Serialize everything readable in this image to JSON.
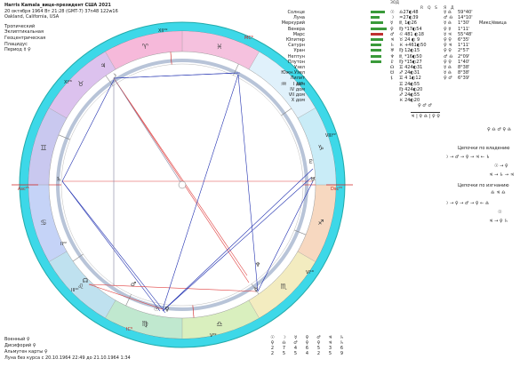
{
  "header": {
    "title": "Harris Kamala_вице-президент США 2021",
    "date_line": "20 октября 1964  Вт  21:28 (GMT-7) 37n48  122w16",
    "place": "Oakland, California, USA",
    "zodiac": "Тропический",
    "coords": "Эклиптикальная",
    "center": "Геоцентрическая",
    "houses": "Плацидус",
    "period": "Период  ☿ ♀"
  },
  "colors": {
    "outer_ring": "#3dd8e8",
    "cusp_red": "#d02020",
    "aspect_blue": "#2030b0",
    "aspect_red": "#e04040",
    "aspect_grey": "#8080a0"
  },
  "table_header": {
    "col_a": "ЗОД",
    "col_b": "R",
    "col_c": "Q",
    "col_d": "S",
    "col_e": "Я",
    "col_f": "Д"
  },
  "planets": [
    {
      "name": "Солнце",
      "glyph": "☉",
      "pos": "♎27◐48",
      "asp": "☿ ♎",
      "val": "59°40'",
      "mix": "",
      "bar": 16,
      "col": "#3a9a3a"
    },
    {
      "name": "Луна",
      "glyph": "☽",
      "pos": "♒27◐39",
      "asp": "♂ ♎",
      "val": "14°10'",
      "mix": "",
      "bar": 10,
      "col": "#3a9a3a"
    },
    {
      "name": "Меркурий",
      "glyph": "☿",
      "pos": "♏ 1◐26",
      "asp": "☿ ♎",
      "val": "1°30'",
      "mix": "Микс/ёвица",
      "bar": 14,
      "col": "#3a9a3a"
    },
    {
      "name": "Венера",
      "glyph": "♀",
      "pos": "♍ *17◐54",
      "asp": "♀ ☿",
      "val": "1°11'",
      "mix": "",
      "bar": 18,
      "col": "#3a9a3a"
    },
    {
      "name": "Марс",
      "glyph": "♂",
      "pos": "♌ 481 ◐18",
      "asp": "☿ ♃",
      "val": "55°48'",
      "mix": "",
      "bar": 14,
      "col": "#c03030"
    },
    {
      "name": "Юпитер",
      "glyph": "♃",
      "pos": "♉ 24 ◐ 9",
      "asp": "♀ ♀",
      "val": "6°35'",
      "mix": "",
      "bar": 14,
      "col": "#3a9a3a"
    },
    {
      "name": "Сатурн",
      "glyph": "♄",
      "pos": "♓ +461◐50",
      "asp": "♀ ♃",
      "val": "1°11'",
      "mix": "",
      "bar": 12,
      "col": "#3a9a3a"
    },
    {
      "name": "Уран",
      "glyph": "♅",
      "pos": "♍ 12◐15",
      "asp": "♀ ♀",
      "val": "2°57'",
      "mix": "",
      "bar": 12,
      "col": "#3a9a3a"
    },
    {
      "name": "Нептун",
      "glyph": "♆",
      "pos": "♏ *16◐50",
      "asp": "♂ ♎",
      "val": "2°09'",
      "mix": "",
      "bar": 12,
      "col": "#3a9a3a"
    },
    {
      "name": "Плутон",
      "glyph": "♇",
      "pos": "♍ *15◐27",
      "asp": "♀ ♀",
      "val": "1°40'",
      "mix": "",
      "bar": 12,
      "col": "#3a9a3a"
    },
    {
      "name": "Узел",
      "glyph": "☊",
      "pos": "♊ 424◐31",
      "asp": "☿ ♎",
      "val": "8°38'",
      "mix": "",
      "bar": 0,
      "col": "#3a9a3a"
    },
    {
      "name": "Южн.Узел",
      "glyph": "☋",
      "pos": "♐ 24◐31",
      "asp": "☿ ♎",
      "val": "8°38'",
      "mix": "",
      "bar": 0,
      "col": "#3a9a3a"
    },
    {
      "name": "Лилит",
      "glyph": "⚸",
      "pos": "♊ 4 1◐12",
      "asp": "♀ ♂",
      "val": "6°39'",
      "mix": "",
      "bar": 0,
      "col": "#3a9a3a"
    },
    {
      "name": "I дом",
      "glyph": "",
      "pos": "♊ 24◐55",
      "asp": "",
      "val": "",
      "mix": "",
      "bar": 0,
      "col": "#3a9a3a"
    },
    {
      "name": "IV дом",
      "glyph": "",
      "pos": "♍ 424◐20",
      "asp": "",
      "val": "",
      "mix": "",
      "bar": 0,
      "col": "#3a9a3a"
    },
    {
      "name": "VII дом",
      "glyph": "",
      "pos": "♐ 24◐55",
      "asp": "",
      "val": "",
      "mix": "",
      "bar": 0,
      "col": "#3a9a3a"
    },
    {
      "name": "X дом",
      "glyph": "",
      "pos": "♓ 24◐20",
      "asp": "",
      "val": "",
      "mix": "",
      "bar": 0,
      "col": "#3a9a3a"
    }
  ],
  "mini_formula": {
    "top": "♀  ♂     ♂",
    "bot": "♃ | ♀  ♎ | ♀  ♀"
  },
  "chains": {
    "title1": "Цепочки по владению",
    "title2": "Цепочки по изгнанию",
    "c1_top": "♀ ♎ ♂ ♀ ♎",
    "c1_mid": "☽ → ♂ → ♀ → ♃ ← ♄",
    "c1_row3": "☉ → ♀",
    "c1_row4": "♃ → ♄ → ♃",
    "c2_row1": "♎ ♃ ♎",
    "c2_row2": "☽ → ♀ → ♂ → ♀ ← ♎",
    "c2_row3": "☉",
    "c2_row4": "♃ → ♀ ♄"
  },
  "footer": {
    "line1": "Военный  ♀",
    "line2": "Дисифорий  ♀",
    "line3": "Альмутен карты  ♀",
    "line4": "Луна без курса с 20.10.1964 22:49 до 21.10.1964  1:34"
  },
  "mini_table": {
    "row1": [
      "☉",
      "☽",
      "☿",
      "♀",
      "♂",
      "♃",
      "♄"
    ],
    "row2": [
      "♀",
      "♎",
      "♂",
      "♀",
      "♀",
      "♃",
      "♄"
    ],
    "row3": [
      "2",
      "7",
      "4",
      "6",
      "5",
      "3",
      "6"
    ],
    "row4": [
      "2",
      "5",
      "5",
      "4",
      "2",
      "5",
      "9"
    ]
  },
  "houses": {
    "h1": "Asc²⁵",
    "h4": "IC⁹",
    "h7": "Dsc²⁵",
    "h10": "MC⁹",
    "h2": "II²²",
    "h3": "III¹⁰",
    "h5": "V²⁹",
    "h6": "VI¹⁹",
    "h8": "VIII²²",
    "h9": "IX⁹",
    "h11": "XI²⁶",
    "h12": "XII¹⁹"
  }
}
